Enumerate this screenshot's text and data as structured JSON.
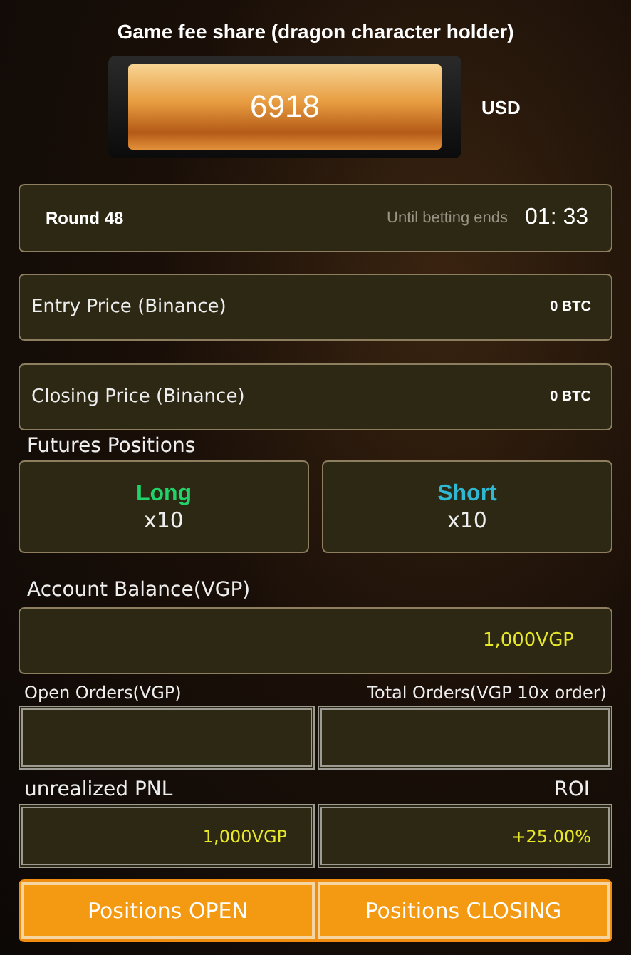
{
  "fee_share": {
    "title": "Game fee share (dragon character holder)",
    "amount": "6918",
    "currency": "USD"
  },
  "round": {
    "label": "Round 48",
    "countdown_label": "Until betting ends",
    "countdown": "01: 33"
  },
  "prices": [
    {
      "label": "Entry Price (Binance)",
      "value": "0 BTC"
    },
    {
      "label": "Closing Price (Binance)",
      "value": "0 BTC"
    }
  ],
  "futures": {
    "title": "Futures Positions",
    "positions": [
      {
        "label": "Long",
        "leverage": "x10",
        "color": "#22d36a"
      },
      {
        "label": "Short",
        "leverage": "x10",
        "color": "#2fb8d2"
      }
    ]
  },
  "account_balance": {
    "label": "Account Balance(VGP)",
    "value": "1,000VGP"
  },
  "orders": [
    {
      "label": "Open Orders(VGP)"
    },
    {
      "label": "Total Orders(VGP 10x order)"
    }
  ],
  "pnl": [
    {
      "label": "unrealized PNL",
      "value": "1,000VGP"
    },
    {
      "label": "ROI",
      "value": "+25.00%"
    }
  ],
  "buttons": [
    "Positions OPEN",
    "Positions CLOSING"
  ]
}
